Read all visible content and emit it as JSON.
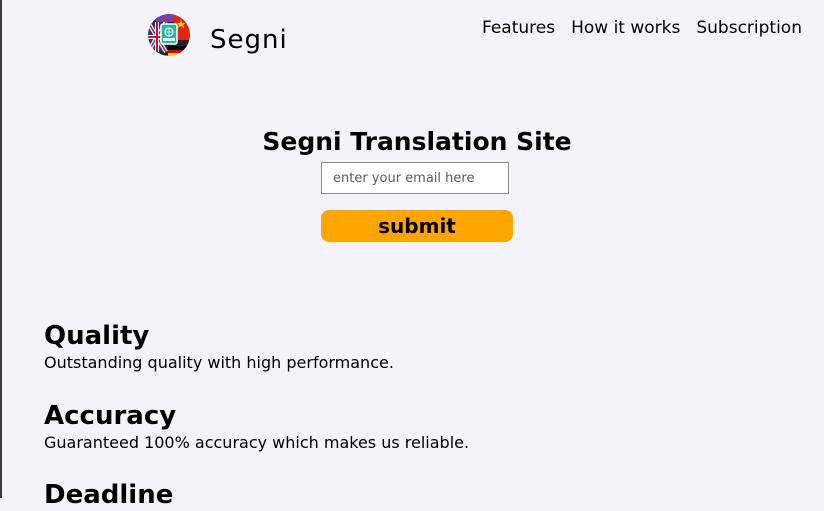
{
  "brand": {
    "name": "Segni",
    "logo_icon": "translation-flags-globe-icon"
  },
  "nav": {
    "items": [
      {
        "label": "Features"
      },
      {
        "label": "How it works"
      },
      {
        "label": "Subscription"
      }
    ]
  },
  "hero": {
    "title": "Segni Translation Site",
    "email_placeholder": "enter your email here",
    "submit_label": "submit"
  },
  "features": [
    {
      "title": "Quality",
      "description": "Outstanding quality with high performance."
    },
    {
      "title": "Accuracy",
      "description": "Guaranteed 100% accuracy which makes us reliable."
    },
    {
      "title": "Deadline",
      "description": ""
    }
  ],
  "colors": {
    "background": "#f4f3f9",
    "accent": "#ffa500"
  }
}
